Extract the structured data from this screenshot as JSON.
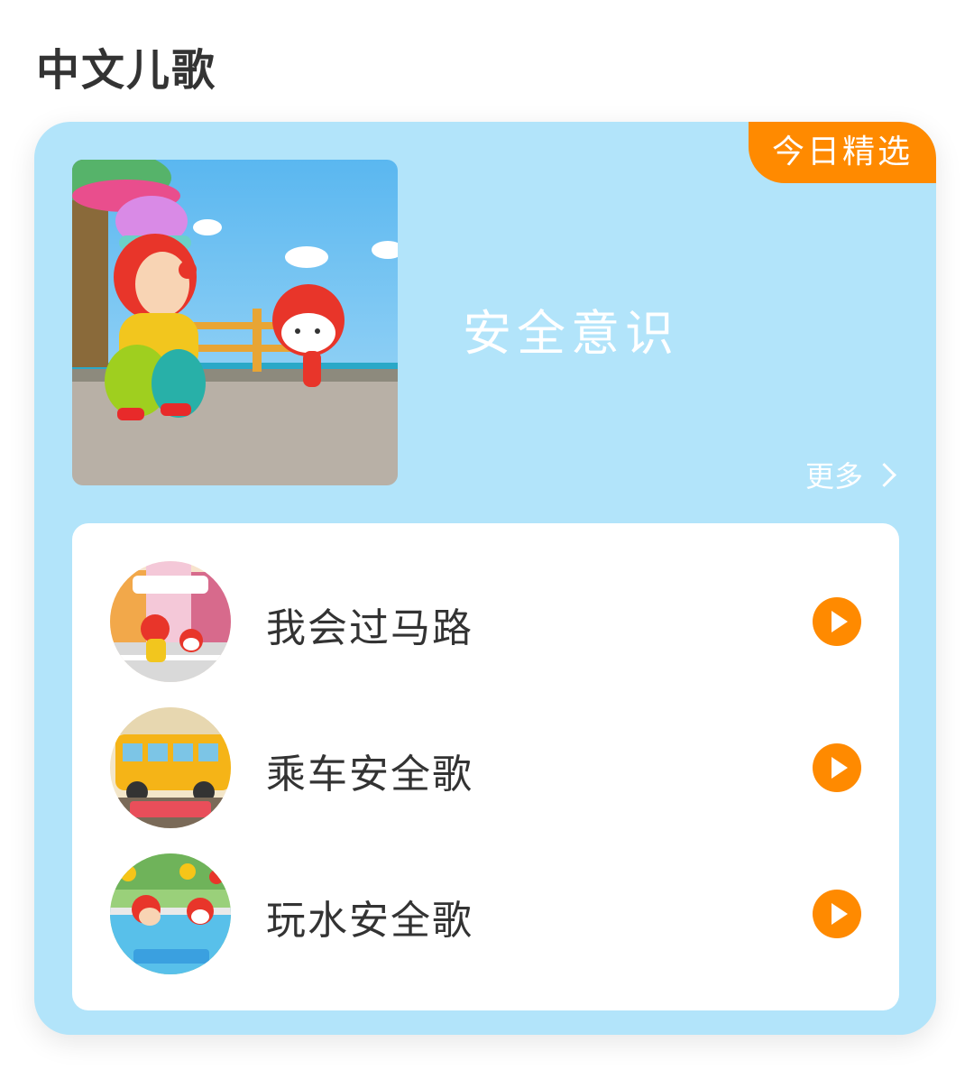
{
  "section": {
    "title": "中文儿歌"
  },
  "card": {
    "badge": "今日精选",
    "feature_title": "安全意识",
    "more_label": "更多",
    "background_color": "#b2e4fa",
    "accent_color": "#ff8a00"
  },
  "songs": [
    {
      "title": "我会过马路",
      "icon": "play-icon"
    },
    {
      "title": "乘车安全歌",
      "icon": "play-icon"
    },
    {
      "title": "玩水安全歌",
      "icon": "play-icon"
    }
  ]
}
